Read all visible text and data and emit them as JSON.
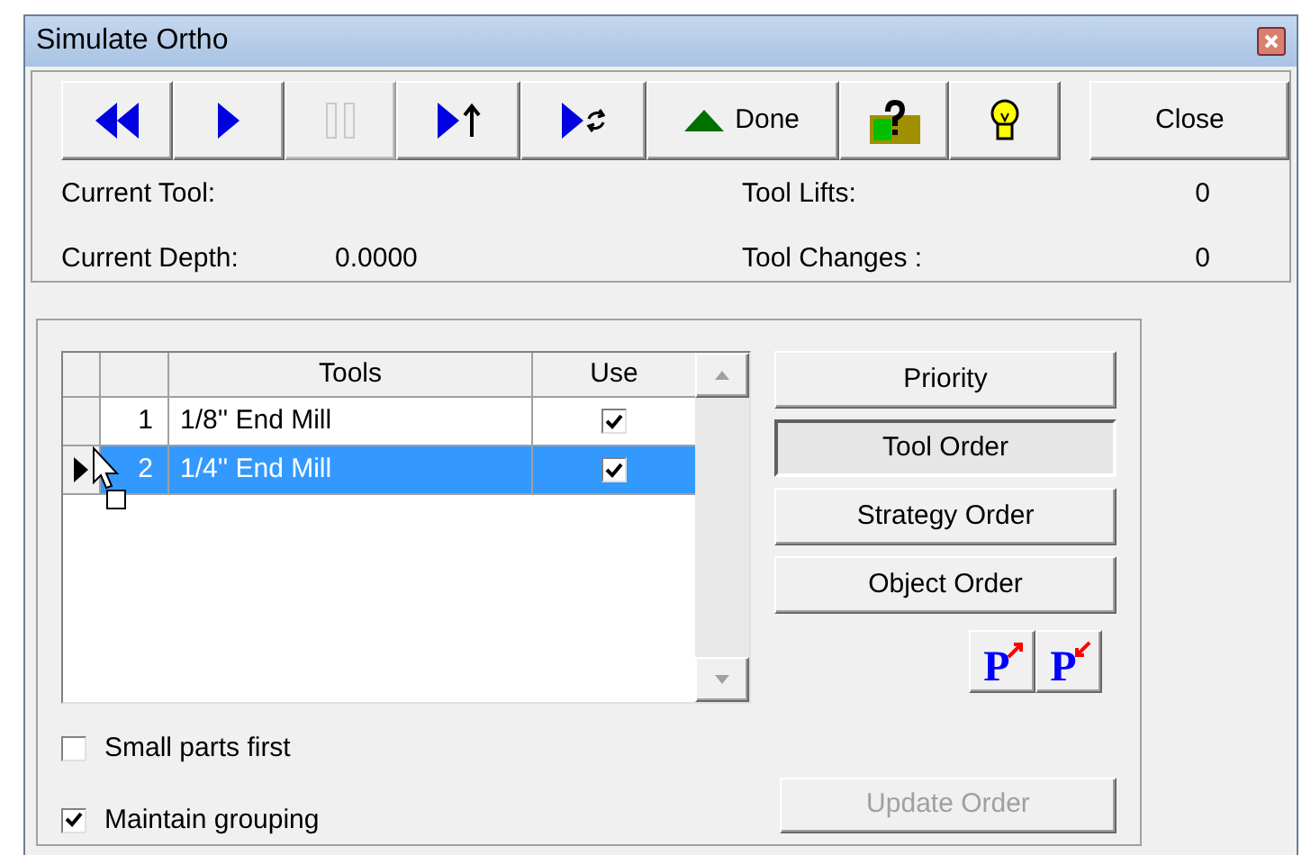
{
  "window": {
    "title": "Simulate Ortho"
  },
  "toolbar": [
    {
      "kind": "rewind",
      "disabled": false
    },
    {
      "kind": "play",
      "disabled": false
    },
    {
      "kind": "pause",
      "disabled": true
    },
    {
      "kind": "play-up",
      "disabled": false
    },
    {
      "kind": "play-cycle",
      "disabled": false
    },
    {
      "kind": "done",
      "label": "Done",
      "disabled": false
    },
    {
      "kind": "help",
      "disabled": false
    },
    {
      "kind": "bulb",
      "disabled": false
    },
    {
      "kind": "close",
      "label": "Close",
      "disabled": false
    }
  ],
  "info": {
    "current_tool_label": "Current Tool:",
    "current_depth_label": "Current Depth:",
    "current_depth": "0.0000",
    "tool_lifts_label": "Tool Lifts:",
    "tool_lifts": "0",
    "tool_changes_label": "Tool Changes :",
    "tool_changes": "0"
  },
  "table": {
    "columns": [
      "Tools",
      "Use"
    ],
    "rows": [
      {
        "number": "1",
        "tool": "1/8'' End Mill",
        "use": true,
        "selected": false,
        "current": false
      },
      {
        "number": "2",
        "tool": "1/4'' End Mill",
        "use": true,
        "selected": true,
        "current": true
      }
    ]
  },
  "order_buttons": [
    {
      "label": "Priority",
      "selected": false
    },
    {
      "label": "Tool Order",
      "selected": true
    },
    {
      "label": "Strategy Order",
      "selected": false
    },
    {
      "label": "Object Order",
      "selected": false
    }
  ],
  "priority_buttons": [
    {
      "label": "P",
      "kind": "up"
    },
    {
      "label": "P",
      "kind": "down"
    }
  ],
  "options": [
    {
      "label": "Small parts first",
      "checked": false
    },
    {
      "label": "Maintain grouping",
      "checked": true
    }
  ],
  "update_button": {
    "label": "Update Order",
    "disabled": true
  }
}
